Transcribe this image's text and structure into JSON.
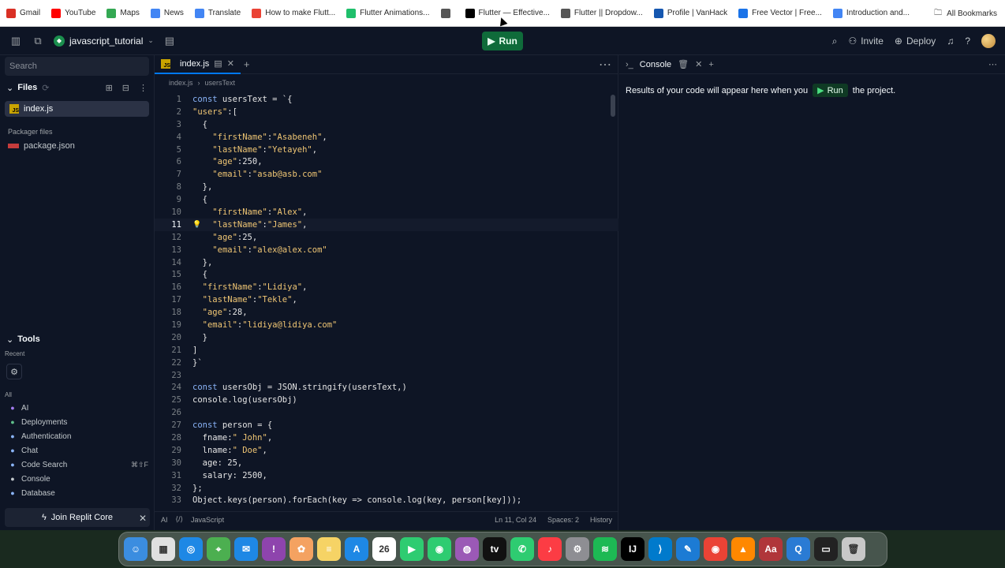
{
  "bookmarks": {
    "items": [
      {
        "label": "Gmail",
        "color": "#d93025"
      },
      {
        "label": "YouTube",
        "color": "#ff0000"
      },
      {
        "label": "Maps",
        "color": "#34a853"
      },
      {
        "label": "News",
        "color": "#4285f4"
      },
      {
        "label": "Translate",
        "color": "#4285f4"
      },
      {
        "label": "How to make Flutt...",
        "color": "#ea4335"
      },
      {
        "label": "Flutter Animations...",
        "color": "#1fbf6b"
      },
      {
        "label": "",
        "color": "#555555"
      },
      {
        "label": "Flutter — Effective...",
        "color": "#000000"
      },
      {
        "label": "Flutter || Dropdow...",
        "color": "#555555"
      },
      {
        "label": "Profile | VanHack",
        "color": "#1557b0"
      },
      {
        "label": "Free Vector | Free...",
        "color": "#1a73e8"
      },
      {
        "label": "Introduction and...",
        "color": "#4285f4"
      }
    ],
    "all_bookmarks": "All Bookmarks"
  },
  "topbar": {
    "repl_name": "javascript_tutorial",
    "run_label": "Run",
    "invite_label": "Invite",
    "deploy_label": "Deploy"
  },
  "sidebar": {
    "search_placeholder": "Search",
    "files_label": "Files",
    "active_file": "index.js",
    "packager_label": "Packager files",
    "package_file": "package.json",
    "tools_label": "Tools",
    "recent_label": "Recent",
    "all_label": "All",
    "tools": [
      {
        "label": "AI",
        "icon": "ai-icon",
        "color": "#a37cf0",
        "kbd": ""
      },
      {
        "label": "Deployments",
        "icon": "deployments-icon",
        "color": "#5fbf8a",
        "kbd": ""
      },
      {
        "label": "Authentication",
        "icon": "auth-icon",
        "color": "#8ab4f8",
        "kbd": ""
      },
      {
        "label": "Chat",
        "icon": "chat-icon",
        "color": "#8ab4f8",
        "kbd": ""
      },
      {
        "label": "Code Search",
        "icon": "code-search-icon",
        "color": "#8ab4f8",
        "kbd": "⌘⇧F"
      },
      {
        "label": "Console",
        "icon": "console-icon",
        "color": "#c2c8cc",
        "kbd": ""
      },
      {
        "label": "Database",
        "icon": "database-icon",
        "color": "#8ab4f8",
        "kbd": ""
      }
    ],
    "join_core": "Join Replit Core"
  },
  "editor": {
    "tab_label": "index.js",
    "crumb_file": "index.js",
    "crumb_symbol": "usersText",
    "current_line": 11,
    "lines": [
      "const usersText = `{",
      "\"users\":[",
      "  {",
      "    \"firstName\":\"Asabeneh\",",
      "    \"lastName\":\"Yetayeh\",",
      "    \"age\":250,",
      "    \"email\":\"asab@asb.com\"",
      "  },",
      "  {",
      "    \"firstName\":\"Alex\",",
      "    \"lastName\":\"James\",",
      "    \"age\":25,",
      "    \"email\":\"alex@alex.com\"",
      "  },",
      "  {",
      "  \"firstName\":\"Lidiya\",",
      "  \"lastName\":\"Tekle\",",
      "  \"age\":28,",
      "  \"email\":\"lidiya@lidiya.com\"",
      "  }",
      "]",
      "}`",
      "",
      "const usersObj = JSON.stringify(usersText,)",
      "console.log(usersObj)",
      "",
      "const person = {",
      "  fname:\" John\",",
      "  lname:\" Doe\",",
      "  age: 25,",
      "  salary: 2500,",
      "};",
      "Object.keys(person).forEach(key => console.log(key, person[key]));"
    ],
    "status": {
      "ai": "AI",
      "language": "JavaScript",
      "cursor_pos": "Ln 11, Col 24",
      "spaces": "Spaces: 2",
      "history": "History"
    }
  },
  "console": {
    "tab_label": "Console",
    "message_before": "Results of your code will appear here when you",
    "run_label": "Run",
    "message_after": "the project."
  },
  "dock": {
    "apps": [
      {
        "name": "finder",
        "color": "#3b8de0",
        "glyph": "☺"
      },
      {
        "name": "launchpad",
        "color": "#e0e0e0",
        "glyph": "▦"
      },
      {
        "name": "safari",
        "color": "#1e88e5",
        "glyph": "◎"
      },
      {
        "name": "maps",
        "color": "#4caf50",
        "glyph": "⌖"
      },
      {
        "name": "mail",
        "color": "#1e88e5",
        "glyph": "✉"
      },
      {
        "name": "podcasts-alt",
        "color": "#8e44ad",
        "glyph": "!"
      },
      {
        "name": "photos",
        "color": "#f4a261",
        "glyph": "✿"
      },
      {
        "name": "notes",
        "color": "#f6d365",
        "glyph": "≡"
      },
      {
        "name": "app-store",
        "color": "#1e88e5",
        "glyph": "A"
      },
      {
        "name": "calendar",
        "color": "#ffffff",
        "glyph": "26"
      },
      {
        "name": "facetime",
        "color": "#2ecc71",
        "glyph": "▶"
      },
      {
        "name": "find-my",
        "color": "#2ecc71",
        "glyph": "◉"
      },
      {
        "name": "podcasts",
        "color": "#9b59b6",
        "glyph": "◍"
      },
      {
        "name": "apple-tv",
        "color": "#111111",
        "glyph": "tv"
      },
      {
        "name": "messages",
        "color": "#2ecc71",
        "glyph": "✆"
      },
      {
        "name": "music",
        "color": "#fc3c44",
        "glyph": "♪"
      },
      {
        "name": "system-settings",
        "color": "#8e8e93",
        "glyph": "⚙"
      },
      {
        "name": "spotify",
        "color": "#1db954",
        "glyph": "≋"
      },
      {
        "name": "intellij",
        "color": "#000000",
        "glyph": "IJ"
      },
      {
        "name": "vscode",
        "color": "#007acc",
        "glyph": "⟩"
      },
      {
        "name": "xcode",
        "color": "#1c7bd4",
        "glyph": "✎"
      },
      {
        "name": "chrome",
        "color": "#ea4335",
        "glyph": "◉"
      },
      {
        "name": "vlc",
        "color": "#ff8800",
        "glyph": "▲"
      },
      {
        "name": "dictionary",
        "color": "#b0363a",
        "glyph": "Aa"
      },
      {
        "name": "quicktime",
        "color": "#2a7bd4",
        "glyph": "Q"
      },
      {
        "name": "stack",
        "color": "#222222",
        "glyph": "▭"
      },
      {
        "name": "trash",
        "color": "#c8c8c8",
        "glyph": "🗑"
      }
    ]
  }
}
